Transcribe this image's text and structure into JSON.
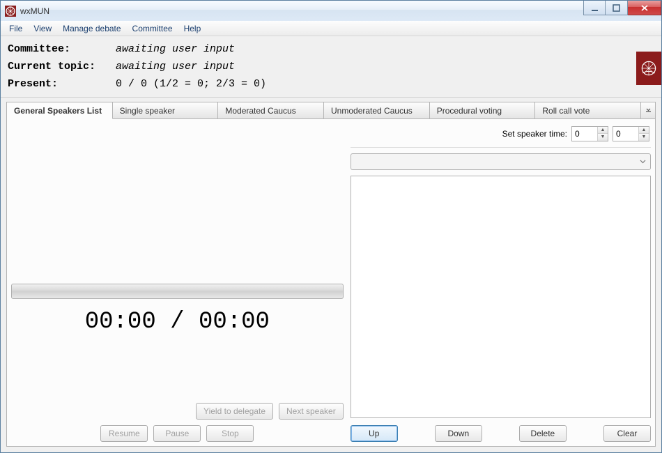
{
  "window": {
    "title": "wxMUN"
  },
  "menu": {
    "file": "File",
    "view": "View",
    "manage_debate": "Manage debate",
    "committee": "Committee",
    "help": "Help"
  },
  "info": {
    "committee_label": "Committee:",
    "committee_value": "awaiting user input",
    "topic_label": "Current topic:",
    "topic_value": "awaiting user input",
    "present_label": "Present:",
    "present_value": "0 / 0  (1/2 = 0; 2/3 = 0)"
  },
  "tabs": {
    "items": [
      {
        "label": "General Speakers List",
        "active": true
      },
      {
        "label": "Single speaker",
        "active": false
      },
      {
        "label": "Moderated Caucus",
        "active": false
      },
      {
        "label": "Unmoderated Caucus",
        "active": false
      },
      {
        "label": "Procedural voting",
        "active": false
      },
      {
        "label": "Roll call vote",
        "active": false
      }
    ]
  },
  "timer": {
    "display": "00:00 / 00:00"
  },
  "left_buttons": {
    "yield": "Yield to delegate",
    "next": "Next speaker",
    "resume": "Resume",
    "pause": "Pause",
    "stop": "Stop"
  },
  "right": {
    "set_speaker_time_label": "Set speaker time:",
    "min": "0",
    "sec": "0",
    "up": "Up",
    "down": "Down",
    "delete": "Delete",
    "clear": "Clear"
  }
}
